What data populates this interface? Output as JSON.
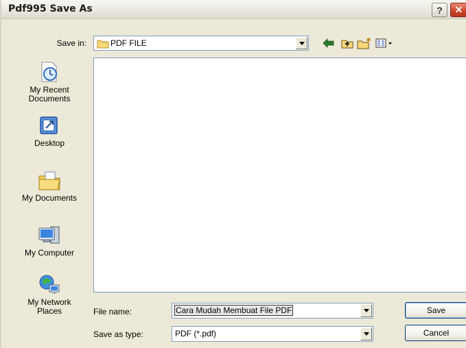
{
  "window": {
    "title": "Pdf995 Save As",
    "help_symbol": "?",
    "close_symbol": "✕"
  },
  "save_in": {
    "label": "Save in:",
    "value": "PDF FILE",
    "icons": [
      "folder-icon",
      "back-arrow-icon",
      "up-folder-icon",
      "new-folder-icon",
      "view-menu-icon"
    ]
  },
  "places": [
    {
      "label": "My Recent Documents",
      "icon": "recent-documents-icon"
    },
    {
      "label": "Desktop",
      "icon": "desktop-icon"
    },
    {
      "label": "My Documents",
      "icon": "my-documents-icon"
    },
    {
      "label": "My Computer",
      "icon": "my-computer-icon"
    },
    {
      "label": "My Network Places",
      "icon": "network-places-icon"
    }
  ],
  "file_name": {
    "label": "File name:",
    "value": "Cara Mudah Membuat File PDF"
  },
  "save_as_type": {
    "label": "Save as type:",
    "value": "PDF (*.pdf)"
  },
  "buttons": {
    "save": "Save",
    "cancel": "Cancel"
  },
  "colors": {
    "dialog_bg": "#ece9d8",
    "field_border": "#7f9db9",
    "close_red": "#c8442a",
    "button_border": "#003c74"
  }
}
